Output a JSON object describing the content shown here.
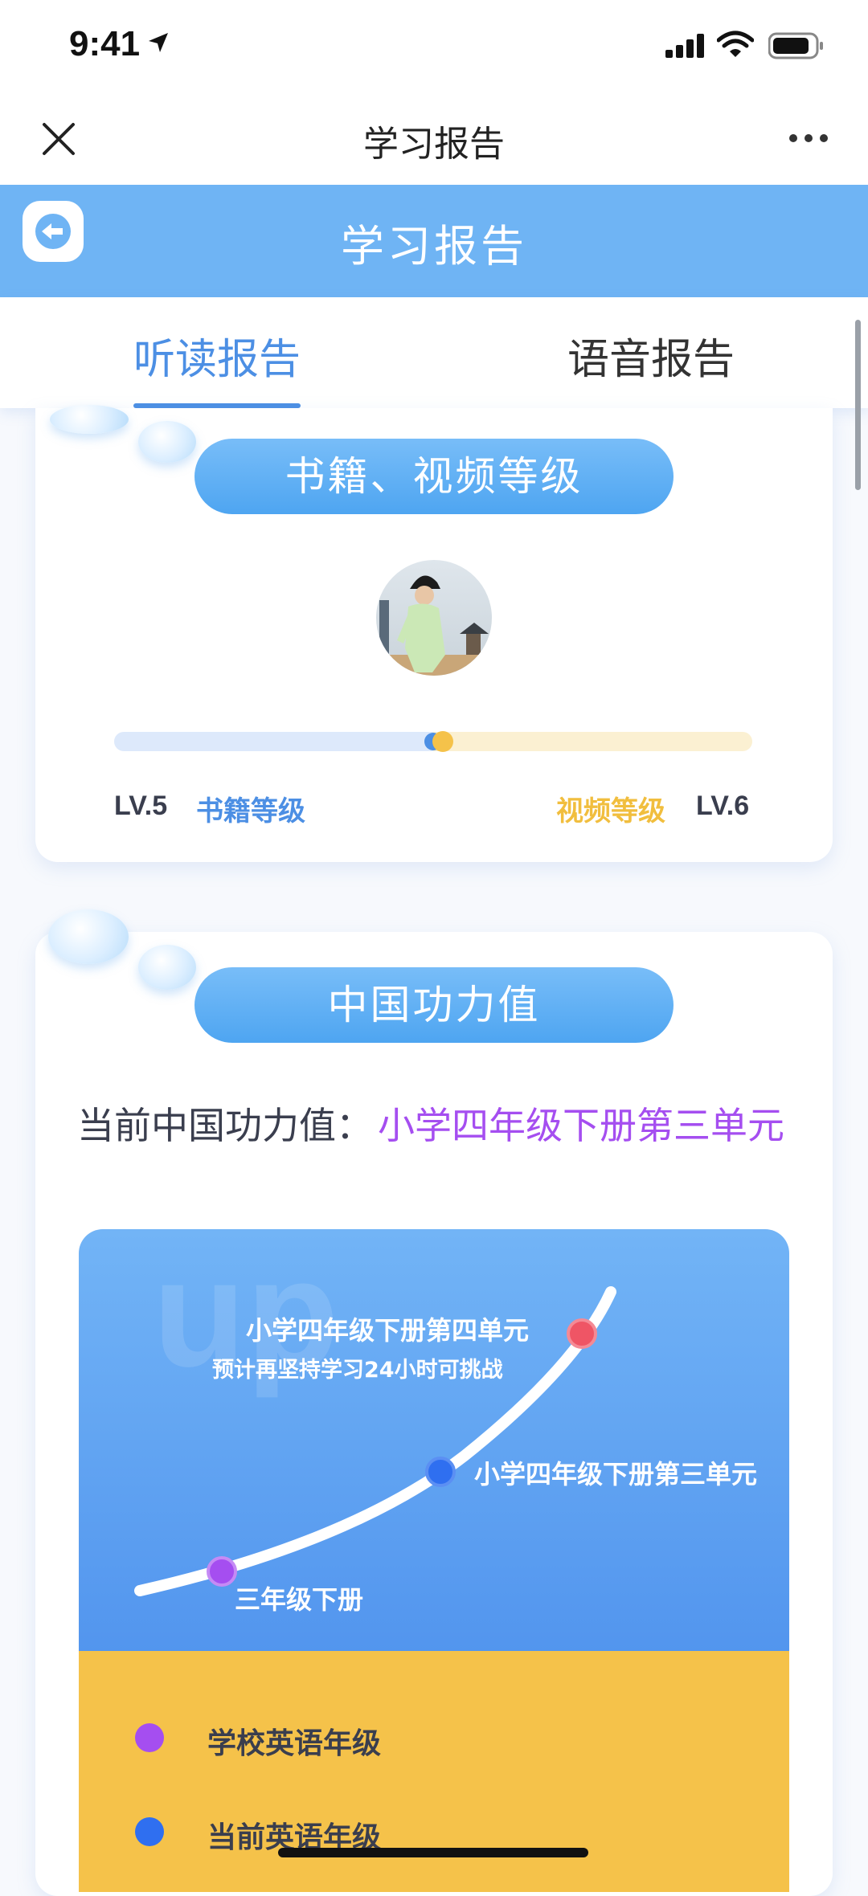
{
  "status_bar": {
    "time": "9:41"
  },
  "nav": {
    "title": "学习报告"
  },
  "header": {
    "title": "学习报告"
  },
  "tabs": [
    {
      "label": "听读报告",
      "active": true
    },
    {
      "label": "语音报告",
      "active": false
    }
  ],
  "level_card": {
    "title": "书籍、视频等级",
    "progress_fraction": 0.5,
    "book": {
      "lv": "LV.5",
      "label": "书籍等级"
    },
    "video": {
      "lv": "LV.6",
      "label": "视频等级"
    }
  },
  "power_card": {
    "title": "中国功力值",
    "current_label": "当前中国功力值：",
    "current_value": "小学四年级下册第三单元",
    "chart": {
      "watermark": "up",
      "points": [
        {
          "label": "三年级下册",
          "color": "#a54ef0"
        },
        {
          "label": "小学四年级下册第三单元",
          "color": "#2f6ff0"
        },
        {
          "label": "小学四年级下册第四单元",
          "sub": "预计再坚持学习24小时可挑战",
          "color": "#ef5565"
        }
      ]
    },
    "legend": [
      {
        "label": "学校英语年级",
        "color": "#a54ef0"
      },
      {
        "label": "当前英语年级",
        "color": "#2f6ff0"
      }
    ]
  }
}
